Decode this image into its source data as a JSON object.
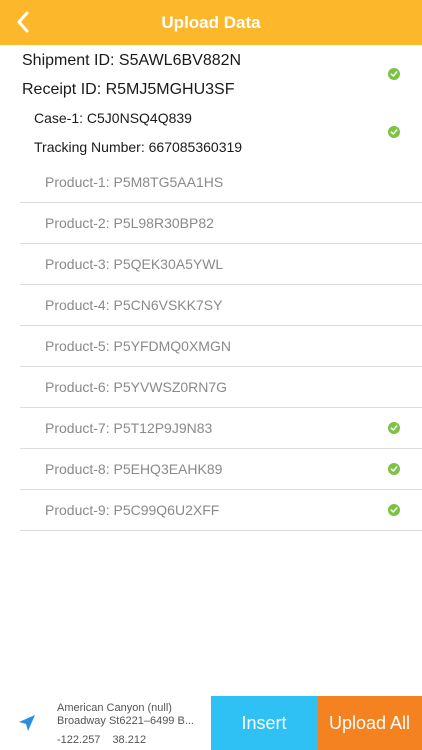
{
  "header": {
    "title": "Upload Data"
  },
  "shipment": {
    "label": "Shipment ID: S5AWL6BV882N"
  },
  "receipt": {
    "label": "Receipt ID: R5MJ5MGHU3SF"
  },
  "case": {
    "label": "Case-1: C5J0NSQ4Q839"
  },
  "tracking": {
    "label": "Tracking Number: 667085360319"
  },
  "products": [
    {
      "label": "Product-1: P5M8TG5AA1HS",
      "checked": false
    },
    {
      "label": "Product-2: P5L98R30BP82",
      "checked": false
    },
    {
      "label": "Product-3: P5QEK30A5YWL",
      "checked": false
    },
    {
      "label": "Product-4: P5CN6VSKK7SY",
      "checked": false
    },
    {
      "label": "Product-5: P5YFDMQ0XMGN",
      "checked": false
    },
    {
      "label": "Product-6: P5YVWSZ0RN7G",
      "checked": false
    },
    {
      "label": "Product-7: P5T12P9J9N83",
      "checked": true
    },
    {
      "label": "Product-8: P5EHQ3EAHK89",
      "checked": true
    },
    {
      "label": "Product-9: P5C99Q6U2XFF",
      "checked": true
    }
  ],
  "location": {
    "line1": "American Canyon (null)",
    "line2": "Broadway St6221–6499 B...",
    "longitude": "-122.257",
    "latitude": "38.212"
  },
  "buttons": {
    "insert": "Insert",
    "upload_all": "Upload All"
  },
  "colors": {
    "header": "#fcb72b",
    "check": "#7cc243",
    "insert": "#2fc1f3",
    "upload": "#f58220",
    "location_arrow": "#2a8fe0"
  },
  "icons": {
    "back": "chevron-left-icon",
    "check": "check-circle-icon",
    "location": "location-arrow-icon"
  }
}
